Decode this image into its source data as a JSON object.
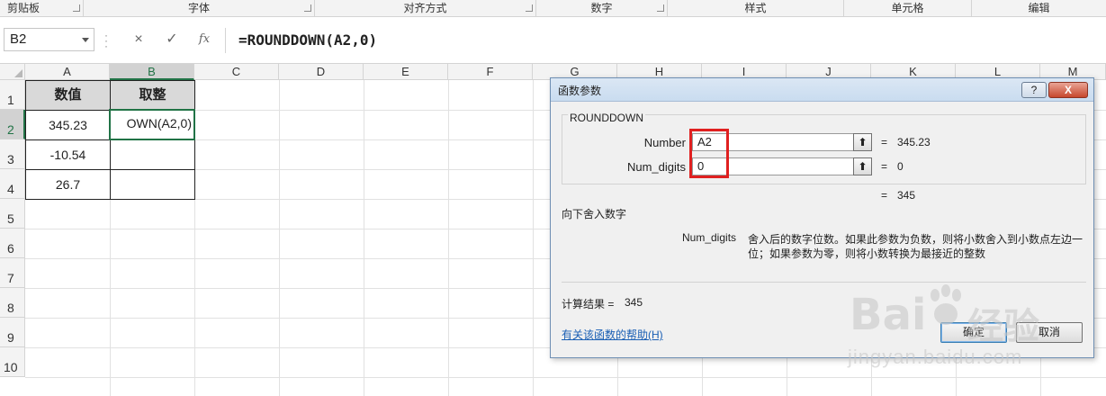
{
  "ribbon": {
    "groups": [
      "剪贴板",
      "字体",
      "对齐方式",
      "数字",
      "样式",
      "单元格",
      "编辑"
    ]
  },
  "formula_bar": {
    "name_box": "B2",
    "cancel_icon": "×",
    "enter_icon": "✓",
    "fx_icon": "fx",
    "formula": "=ROUNDDOWN(A2,0)"
  },
  "sheet": {
    "columns": [
      "A",
      "B",
      "C",
      "D",
      "E",
      "F",
      "G",
      "H",
      "I",
      "J",
      "K",
      "L",
      "M"
    ],
    "rows": [
      "1",
      "2",
      "3",
      "4",
      "5",
      "6",
      "7",
      "8",
      "9",
      "10"
    ],
    "header_a": "数值",
    "header_b": "取整",
    "values_a": [
      "345.23",
      "-10.54",
      "26.7"
    ],
    "edit_text_b2": "OWN(A2,0)"
  },
  "dialog": {
    "title": "函数参数",
    "help_button": "?",
    "close_button": "X",
    "function_name": "ROUNDDOWN",
    "args": [
      {
        "label": "Number",
        "value": "A2",
        "result": "345.23"
      },
      {
        "label": "Num_digits",
        "value": "0",
        "result": "0"
      }
    ],
    "equals": "=",
    "collapse_icon": "⬆",
    "formula_result_top": "345",
    "description": "向下舍入数字",
    "arg_desc_name": "Num_digits",
    "arg_desc_line1": "舍入后的数字位数。如果此参数为负数，则将小数舍入到小数点左边一",
    "arg_desc_line2": "位；如果参数为零，则将小数转换为最接近的整数",
    "calc_label": "计算结果 =",
    "calc_value": "345",
    "help_link": "有关该函数的帮助(H)",
    "ok_button": "确定",
    "cancel_button": "取消"
  },
  "watermark": {
    "brand": "Bai",
    "brand_cn": "经验",
    "url": "jingyan.baidu.com"
  },
  "colors": {
    "excel_green": "#217346",
    "highlight_red": "#e02020",
    "link_blue": "#1a5fb4"
  }
}
